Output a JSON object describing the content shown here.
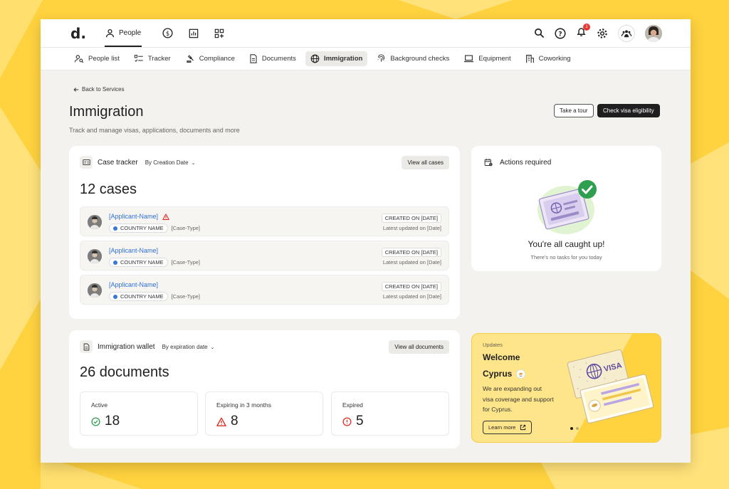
{
  "colors": {
    "background": "#FFD23F",
    "accent_dark": "#1f1f1f",
    "link_blue": "#2F6FD6",
    "success": "#2E9E4F",
    "warning": "#D93025",
    "error": "#D93025"
  },
  "topbar": {
    "logo": "d.",
    "nav": [
      {
        "icon": "person-icon",
        "label": "People",
        "active": true
      },
      {
        "icon": "dollar-icon",
        "label": ""
      },
      {
        "icon": "chart-icon",
        "label": ""
      },
      {
        "icon": "apps-add-icon",
        "label": ""
      }
    ],
    "notification_count": "1",
    "right_icons": [
      "search-icon",
      "help-icon",
      "bell-icon",
      "gear-icon",
      "team-icon",
      "avatar"
    ]
  },
  "subnav": {
    "items": [
      {
        "icon": "people-search-icon",
        "label": "People list"
      },
      {
        "icon": "tracker-icon",
        "label": "Tracker"
      },
      {
        "icon": "gavel-icon",
        "label": "Compliance"
      },
      {
        "icon": "document-icon",
        "label": "Documents"
      },
      {
        "icon": "globe-icon",
        "label": "Immigration",
        "active": true
      },
      {
        "icon": "fingerprint-icon",
        "label": "Background checks"
      },
      {
        "icon": "laptop-icon",
        "label": "Equipment"
      },
      {
        "icon": "building-icon",
        "label": "Coworking"
      }
    ]
  },
  "page": {
    "back_label": "Back to Services",
    "title": "Immigration",
    "subtitle": "Track and manage visas, applications, documents and more",
    "tour_button": "Take a tour",
    "check_button": "Check visa eligibility"
  },
  "case_tracker": {
    "title": "Case tracker",
    "sort_label": "By Creation Date",
    "view_all": "View all cases",
    "count": "12 cases",
    "cases": [
      {
        "name": "[Applicant-Name]",
        "warning": true,
        "country": "COUNTRY NAME",
        "type": "[Case-Type]",
        "created": "CREATED ON [DATE]",
        "updated": "Latest updated on [Date]"
      },
      {
        "name": "[Applicant-Name]",
        "warning": false,
        "country": "COUNTRY NAME",
        "type": "[Case-Type]",
        "created": "CREATED ON [DATE]",
        "updated": "Latest updated on [Date]"
      },
      {
        "name": "[Applicant-Name]",
        "warning": false,
        "country": "COUNTRY NAME",
        "type": "[Case-Type]",
        "created": "CREATED ON [DATE]",
        "updated": "Latest updated on [Date]"
      }
    ]
  },
  "wallet": {
    "title": "Immigration wallet",
    "sort_label": "By expiration date",
    "view_all": "View all documents",
    "count": "26 documents",
    "stats": [
      {
        "label": "Active",
        "value": "18",
        "icon": "check-circle-icon"
      },
      {
        "label": "Expiring in 3 months",
        "value": "8",
        "icon": "warning-triangle-icon"
      },
      {
        "label": "Expired",
        "value": "5",
        "icon": "alert-circle-icon"
      }
    ]
  },
  "actions": {
    "title": "Actions required",
    "heading": "You're all caught up!",
    "sub": "There's no tasks for you today"
  },
  "updates": {
    "eyebrow": "Updates",
    "title_line1": "Welcome",
    "title_line2": "Cyprus",
    "body": "We are expanding out visa coverage and support for Cyprus.",
    "learn_more": "Learn more",
    "visa_text": "VISA",
    "carousel_count": 2,
    "carousel_active": 1
  }
}
